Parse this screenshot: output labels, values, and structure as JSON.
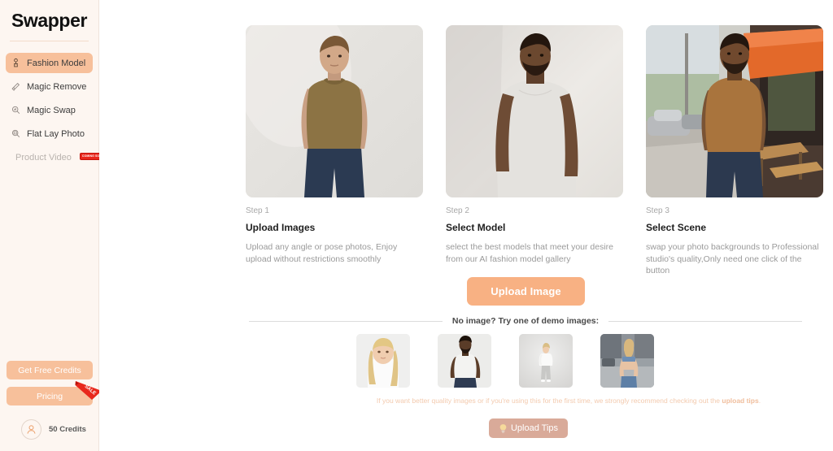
{
  "sidebar": {
    "logo": "Swapper",
    "nav": [
      {
        "label": "Fashion Model",
        "icon": "mannequin-icon",
        "active": true
      },
      {
        "label": "Magic Remove",
        "icon": "eraser-icon",
        "active": false
      },
      {
        "label": "Magic Swap",
        "icon": "magnifier-swap-icon",
        "active": false
      },
      {
        "label": "Flat Lay Photo",
        "icon": "magnifier-photo-icon",
        "active": false
      },
      {
        "label": "Product Video",
        "icon": "none",
        "active": false,
        "badge": "COMING SOON"
      }
    ],
    "free_credits_label": "Get Free Credits",
    "pricing_label": "Pricing",
    "sale_ribbon": "SALE",
    "credits": "50 Credits"
  },
  "main": {
    "steps": [
      {
        "num": "Step 1",
        "title": "Upload Images",
        "desc": "Upload any angle or pose photos, Enjoy upload without restrictions smoothly",
        "image": "man-in-olive-tshirt-studio"
      },
      {
        "num": "Step 2",
        "title": "Select Model",
        "desc": "select the best models that meet your desire from our AI fashion model gallery",
        "image": "man-in-white-tshirt-studio"
      },
      {
        "num": "Step 3",
        "title": "Select Scene",
        "desc": "swap your photo backgrounds to Professional studio's quality,Only need one click of the button",
        "image": "man-in-tan-tshirt-street"
      }
    ],
    "upload_button": "Upload Image",
    "demo_divider_text": "No image? Try one of demo images:",
    "demo_images": [
      {
        "name": "girl-white-tee"
      },
      {
        "name": "man-white-tee-jeans"
      },
      {
        "name": "woman-white-top-grey-pants"
      },
      {
        "name": "woman-denim-outfit-street"
      }
    ],
    "warning_text_1": "If you want better quality images or if you're using this for the first time, we strongly recommend checking out the ",
    "warning_text_bold": "upload tips",
    "warning_text_2": ".",
    "tips_button": "Upload Tips",
    "tips_icon": "lightbulb-icon"
  },
  "colors": {
    "sidebar_bg": "#FDF6F1",
    "accent_peach": "#F7C09B",
    "upload_btn": "#F8B183",
    "sale_red": "#E8271C",
    "tips_btn": "#D9AA99",
    "warn_text": "#F3CAAE"
  }
}
